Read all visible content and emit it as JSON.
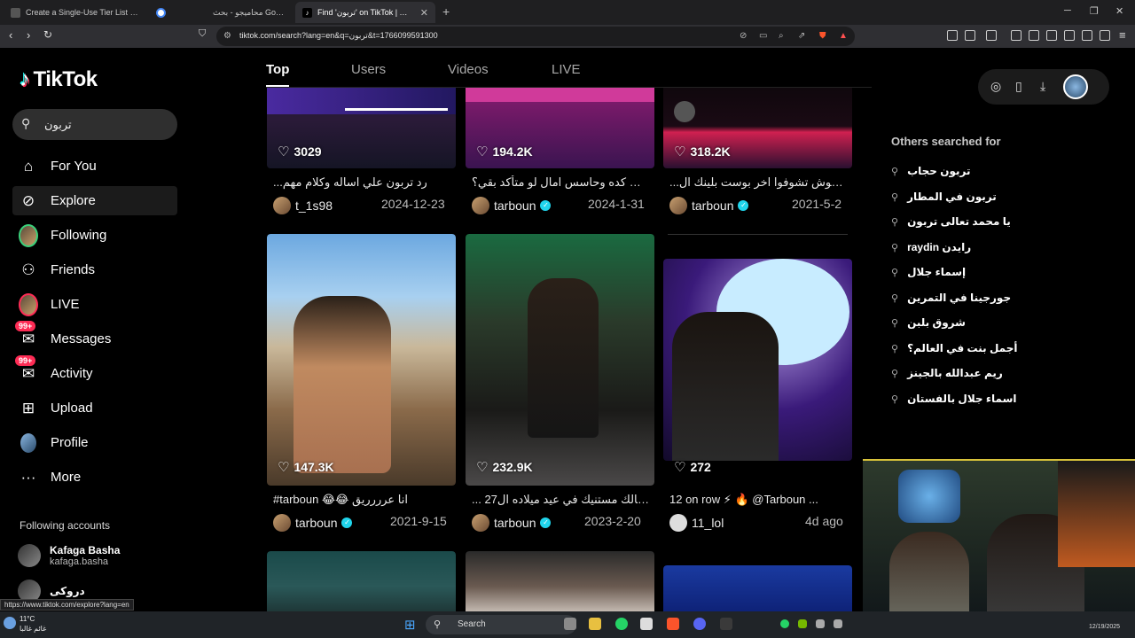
{
  "browser": {
    "tabs": [
      {
        "title": "Create a Single-Use Tier List (Private"
      },
      {
        "title": ""
      },
      {
        "title": "محاميجو - بحث Google"
      },
      {
        "title": "Find 'تربون' on TikTok | TikTok"
      }
    ],
    "url": "tiktok.com/search?lang=en&q=تربون&t=1766099591300",
    "status_url": "https://www.tiktok.com/explore?lang=en"
  },
  "sidebar": {
    "logo": "TikTok",
    "search_value": "تربون",
    "items": [
      {
        "label": "For You",
        "icon": "home-icon"
      },
      {
        "label": "Explore",
        "icon": "compass-icon"
      },
      {
        "label": "Following",
        "icon": "following-avatar-icon"
      },
      {
        "label": "Friends",
        "icon": "friends-icon"
      },
      {
        "label": "LIVE",
        "icon": "live-avatar-icon"
      },
      {
        "label": "Messages",
        "icon": "messages-icon",
        "badge": "99+"
      },
      {
        "label": "Activity",
        "icon": "inbox-icon",
        "badge": "99+"
      },
      {
        "label": "Upload",
        "icon": "plus-square-icon"
      },
      {
        "label": "Profile",
        "icon": "profile-avatar-icon"
      },
      {
        "label": "More",
        "icon": "ellipsis-icon"
      }
    ],
    "following_title": "Following accounts",
    "following": [
      {
        "name": "Kafaga Basha",
        "username": "kafaga.basha"
      },
      {
        "name": "دروكى",
        "username": ""
      }
    ]
  },
  "search_tabs": [
    "Top",
    "Users",
    "Videos",
    "LIVE"
  ],
  "videos": [
    {
      "likes": "3029",
      "desc": "...رد تربون علي اساله وكلام مهم",
      "author": "t_1s98",
      "verified": false,
      "date": "2024-12-23"
    },
    {
      "likes": "194.2K",
      "desc": "كده وحاسس امال لو متأكد بقي؟ 😂🥺",
      "author": "tarboun",
      "verified": true,
      "date": "2024-1-31"
    },
    {
      "likes": "318.2K",
      "desc": "...بكم،متنسوش تشوفوا اخر بوست بلينك ال",
      "author": "tarboun",
      "verified": true,
      "date": "2021-5-2"
    },
    {
      "likes": "147.3K",
      "desc": "#tarboun 😂😂 انا عرررريق",
      "author": "tarboun",
      "verified": true,
      "date": "2021-9-15"
    },
    {
      "likes": "232.9K",
      "desc": "... السالك مستنيك في عيد ميلاده ال27😭",
      "author": "tarboun",
      "verified": true,
      "date": "2023-2-20"
    },
    {
      "likes": "272",
      "desc": "12 on row ⚡ 🔥 @Tarboun ...",
      "author": "11_lol",
      "verified": false,
      "date": "4d ago"
    },
    {
      "likes": "",
      "desc": "",
      "author": "",
      "verified": false,
      "date": ""
    },
    {
      "likes": "",
      "desc": "",
      "author": "",
      "verified": false,
      "date": ""
    },
    {
      "likes": "",
      "desc": "",
      "author": "",
      "verified": false,
      "date": ""
    }
  ],
  "right_panel": {
    "others_title": "Others searched for",
    "suggestions": [
      "تربون حجاب",
      "تربون في المطار",
      "يا محمد تعالى تربون",
      "raydin رايدن",
      "إسماء جلال",
      "جورجينا في التمرين",
      "شروق بلبن",
      "أجمل بنت في العالم؟",
      "ريم عبدالله بالجينز",
      "اسماء جلال بالفستان"
    ]
  },
  "taskbar": {
    "weather_temp": "11°C",
    "weather_desc": "غائم غالبا",
    "search_label": "Search",
    "date": "12/19/2025"
  }
}
